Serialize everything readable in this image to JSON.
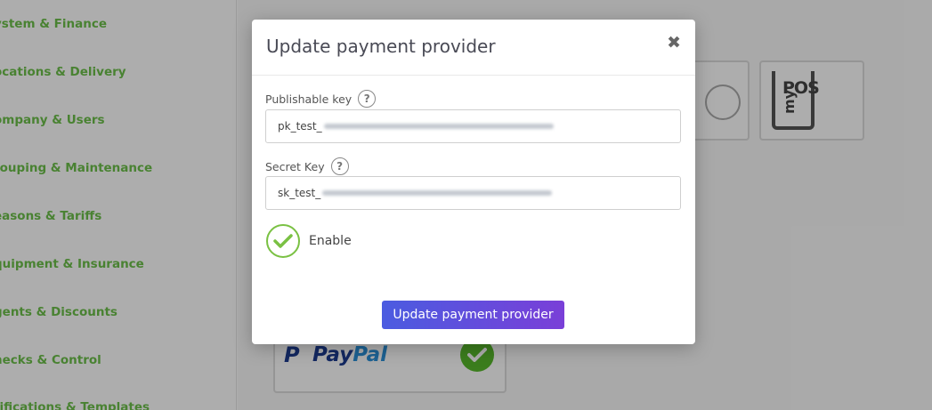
{
  "sidebar": {
    "items": [
      {
        "label": "ystem & Finance"
      },
      {
        "label": "ocations & Delivery"
      },
      {
        "label": "ompany & Users"
      },
      {
        "label": "rouping & Maintenance"
      },
      {
        "label": "easons & Tariffs"
      },
      {
        "label": "quipment & Insurance"
      },
      {
        "label": "gents & Discounts"
      },
      {
        "label": "hecks & Control"
      },
      {
        "label": "tifications & Templates"
      }
    ],
    "item_color": "#6cc04a"
  },
  "providers": {
    "mypos_logo_pos": "POS",
    "mypos_logo_my": "my",
    "paypal_logo_pay": "Pay",
    "paypal_logo_pal": "Pal",
    "paypal_logo_p": "P"
  },
  "modal": {
    "title": "Update payment provider",
    "close_icon": "close-icon",
    "publishable_key": {
      "label": "Publishable key",
      "value_prefix": "pk_test_"
    },
    "secret_key": {
      "label": "Secret Key",
      "value_prefix": "sk_test_"
    },
    "help_glyph": "?",
    "enable_label": "Enable",
    "enable_checked": true,
    "submit_label": "Update payment provider",
    "accent_color": "#7ac143",
    "button_gradient": [
      "#4b5ce0",
      "#7a3fd8"
    ]
  }
}
